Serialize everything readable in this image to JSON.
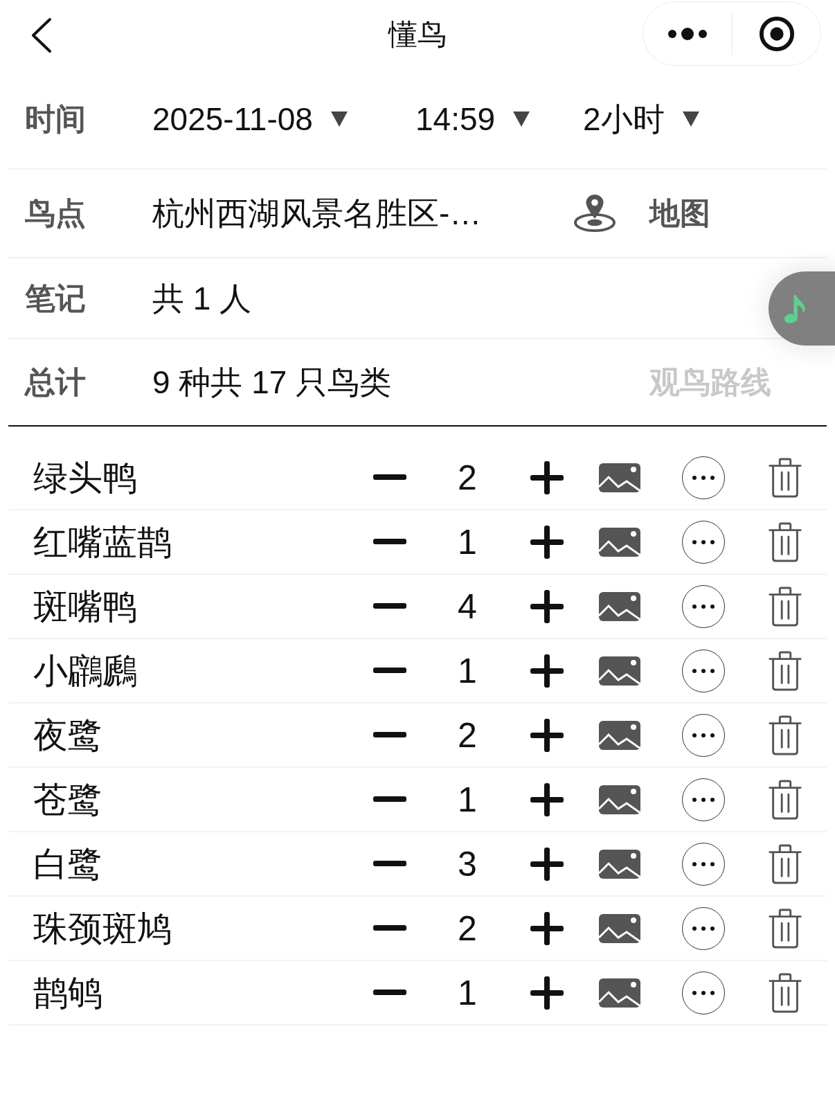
{
  "nav": {
    "title": "懂鸟"
  },
  "time": {
    "label": "时间",
    "date": "2025-11-08",
    "clock": "14:59",
    "duration": "2小时"
  },
  "spot": {
    "label": "鸟点",
    "value": "杭州西湖风景名胜区-…",
    "map_label": "地图"
  },
  "notes": {
    "label": "笔记",
    "value": "共 1 人"
  },
  "total": {
    "label": "总计",
    "value": "9 种共 17 只鸟类",
    "route_label": "观鸟路线"
  },
  "birds": [
    {
      "name": "绿头鸭",
      "count": "2"
    },
    {
      "name": "红嘴蓝鹊",
      "count": "1"
    },
    {
      "name": "斑嘴鸭",
      "count": "4"
    },
    {
      "name": "小鸊鷉",
      "count": "1"
    },
    {
      "name": "夜鹭",
      "count": "2"
    },
    {
      "name": "苍鹭",
      "count": "1"
    },
    {
      "name": "白鹭",
      "count": "3"
    },
    {
      "name": "珠颈斑鸠",
      "count": "2"
    },
    {
      "name": "鹊鸲",
      "count": "1"
    }
  ]
}
